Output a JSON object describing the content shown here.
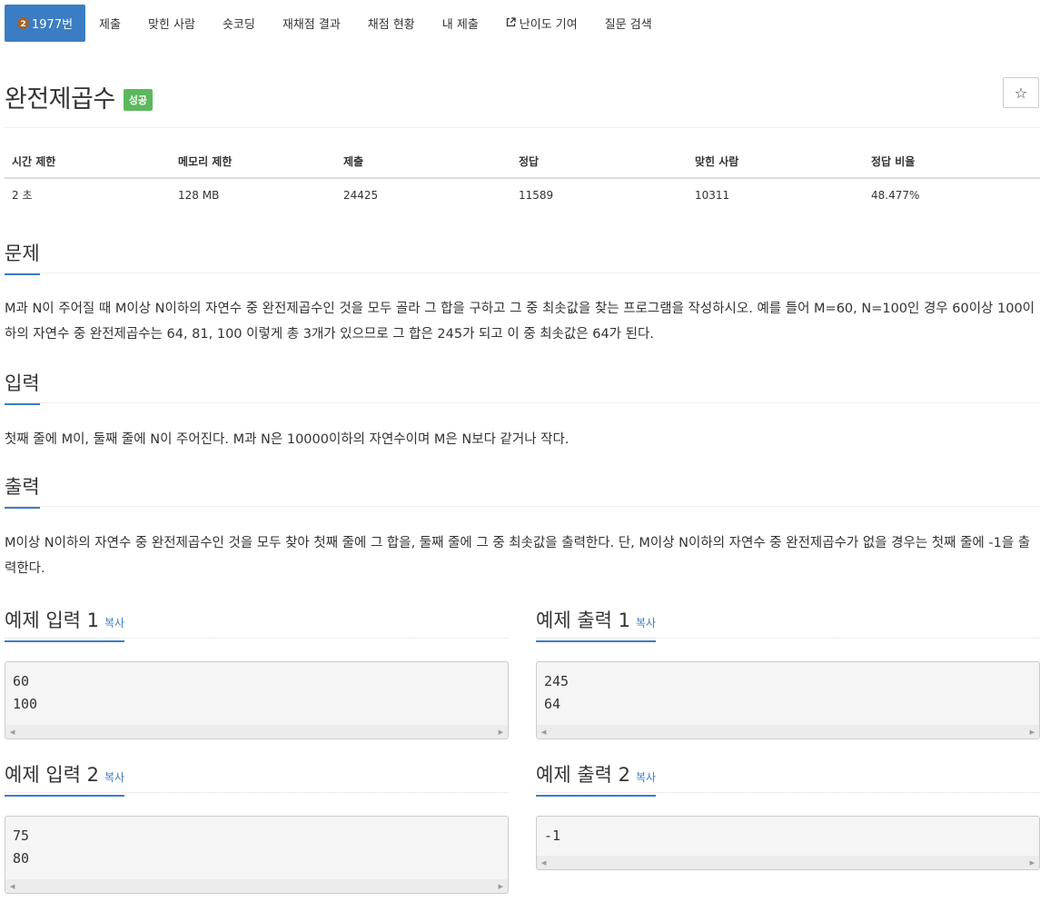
{
  "tabs": [
    {
      "label": "1977번",
      "active": true,
      "icon": "rank-badge-icon"
    },
    {
      "label": "제출"
    },
    {
      "label": "맞힌 사람"
    },
    {
      "label": "숏코딩"
    },
    {
      "label": "재채점 결과"
    },
    {
      "label": "채점 현황"
    },
    {
      "label": "내 제출"
    },
    {
      "label": "난이도 기여",
      "icon": "external-link-icon"
    },
    {
      "label": "질문 검색"
    }
  ],
  "badge_digit": "2",
  "problem": {
    "title": "완전제곱수",
    "status": "성공",
    "star_icon": "star-icon"
  },
  "info": {
    "headers": [
      "시간 제한",
      "메모리 제한",
      "제출",
      "정답",
      "맞힌 사람",
      "정답 비율"
    ],
    "values": [
      "2 초",
      "128 MB",
      "24425",
      "11589",
      "10311",
      "48.477%"
    ]
  },
  "sections": {
    "problem": {
      "heading": "문제",
      "body": "M과 N이 주어질 때 M이상 N이하의 자연수 중 완전제곱수인 것을 모두 골라 그 합을 구하고 그 중 최솟값을 찾는 프로그램을 작성하시오. 예를 들어 M=60, N=100인 경우 60이상 100이하의 자연수 중 완전제곱수는 64, 81, 100 이렇게 총 3개가 있으므로 그 합은 245가 되고 이 중 최솟값은 64가 된다."
    },
    "input": {
      "heading": "입력",
      "body": "첫째 줄에 M이, 둘째 줄에 N이 주어진다. M과 N은 10000이하의 자연수이며 M은 N보다 같거나 작다."
    },
    "output": {
      "heading": "출력",
      "body": "M이상 N이하의 자연수 중 완전제곱수인 것을 모두 찾아 첫째 줄에 그 합을, 둘째 줄에 그 중 최솟값을 출력한다. 단, M이상 N이하의 자연수 중 완전제곱수가 없을 경우는 첫째 줄에 -1을 출력한다."
    }
  },
  "copy_label": "복사",
  "samples": {
    "input1": {
      "title": "예제 입력 1",
      "content": "60\n100"
    },
    "output1": {
      "title": "예제 출력 1",
      "content": "245\n64"
    },
    "input2": {
      "title": "예제 입력 2",
      "content": "75\n80"
    },
    "output2": {
      "title": "예제 출력 2",
      "content": "-1"
    }
  },
  "colors": {
    "accent": "#3b7dc4",
    "success": "#5cb85c"
  }
}
